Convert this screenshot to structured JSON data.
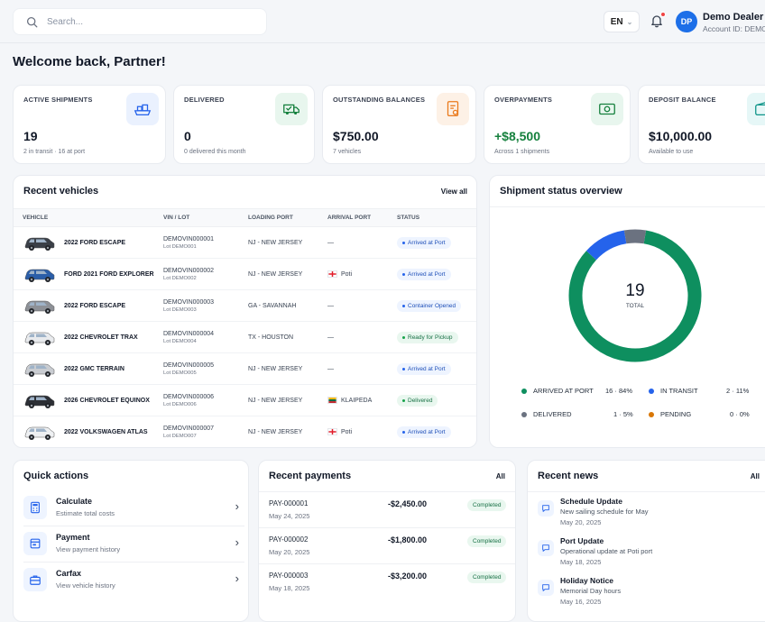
{
  "header": {
    "search_placeholder": "Search...",
    "language": "EN",
    "user": {
      "initials": "DP",
      "name": "Demo Dealer",
      "account": "Account ID: DEMO"
    }
  },
  "welcome": "Welcome back, Partner!",
  "stats": [
    {
      "label": "ACTIVE SHIPMENTS",
      "value": "19",
      "sub": "2 in transit · 16 at port",
      "icon": "ship-icon",
      "value_color": "#111827"
    },
    {
      "label": "DELIVERED",
      "value": "0",
      "sub": "0 delivered this month",
      "icon": "truck-check-icon",
      "value_color": "#111827"
    },
    {
      "label": "OUTSTANDING BALANCES",
      "value": "$750.00",
      "sub": "7 vehicles",
      "icon": "invoice-icon",
      "value_color": "#111827"
    },
    {
      "label": "OVERPAYMENTS",
      "value": "+$8,500",
      "sub": "Across 1 shipments",
      "icon": "cash-icon",
      "value_color": "#15803d"
    },
    {
      "label": "DEPOSIT BALANCE",
      "value": "$10,000.00",
      "sub": "Available to use",
      "icon": "wallet-icon",
      "value_color": "#111827"
    }
  ],
  "recent_vehicles": {
    "title": "Recent vehicles",
    "view_all": "View all",
    "columns": [
      "VEHICLE",
      "VIN / LOT",
      "LOADING PORT",
      "ARRIVAL PORT",
      "STATUS"
    ],
    "rows": [
      {
        "vehicle": "2022 FORD ESCAPE",
        "vin": "DEMOVIN000001",
        "lot": "Lot DEMO001",
        "loading": "NJ - NEW JERSEY",
        "arrival": "—",
        "flag": "",
        "status": "Arrived at Port",
        "status_tone": "blue",
        "car_color": "#3a3f47"
      },
      {
        "vehicle": "FORD 2021 FORD EXPLORER",
        "vin": "DEMOVIN000002",
        "lot": "Lot DEMO002",
        "loading": "NJ - NEW JERSEY",
        "arrival": "Poti",
        "flag": "georgia",
        "status": "Arrived at Port",
        "status_tone": "blue",
        "car_color": "#2b5ea8"
      },
      {
        "vehicle": "2022 FORD ESCAPE",
        "vin": "DEMOVIN000003",
        "lot": "Lot DEMO003",
        "loading": "GA - SAVANNAH",
        "arrival": "—",
        "flag": "",
        "status": "Container Opened",
        "status_tone": "blue",
        "car_color": "#8d9096"
      },
      {
        "vehicle": "2022 CHEVROLET TRAX",
        "vin": "DEMOVIN000004",
        "lot": "Lot DEMO004",
        "loading": "TX - HOUSTON",
        "arrival": "—",
        "flag": "",
        "status": "Ready for Pickup",
        "status_tone": "green",
        "car_color": "#e8eaed"
      },
      {
        "vehicle": "2022 GMC TERRAIN",
        "vin": "DEMOVIN000005",
        "lot": "Lot DEMO005",
        "loading": "NJ - NEW JERSEY",
        "arrival": "—",
        "flag": "",
        "status": "Arrived at Port",
        "status_tone": "blue",
        "car_color": "#c9ccd1"
      },
      {
        "vehicle": "2026 CHEVROLET EQUINOX",
        "vin": "DEMOVIN000006",
        "lot": "Lot DEMO006",
        "loading": "NJ - NEW JERSEY",
        "arrival": "KLAIPEDA",
        "flag": "lithuania",
        "status": "Delivered",
        "status_tone": "green",
        "car_color": "#2c2f35"
      },
      {
        "vehicle": "2022 VOLKSWAGEN ATLAS",
        "vin": "DEMOVIN000007",
        "lot": "Lot DEMO007",
        "loading": "NJ - NEW JERSEY",
        "arrival": "Poti",
        "flag": "georgia",
        "status": "Arrived at Port",
        "status_tone": "blue",
        "car_color": "#eef0f2"
      }
    ]
  },
  "shipment_overview": {
    "title": "Shipment status overview",
    "total": "19",
    "total_label": "TOTAL",
    "legend": [
      {
        "label": "ARRIVED AT PORT",
        "value": "16 · 84%",
        "color": "#0e8f5f"
      },
      {
        "label": "IN TRANSIT",
        "value": "2 · 11%",
        "color": "#2563eb"
      },
      {
        "label": "DELIVERED",
        "value": "1 · 5%",
        "color": "#6b7280"
      },
      {
        "label": "PENDING",
        "value": "0 · 0%",
        "color": "#d97706"
      }
    ]
  },
  "chart_data": {
    "type": "pie",
    "categories": [
      "ARRIVED AT PORT",
      "IN TRANSIT",
      "DELIVERED",
      "PENDING"
    ],
    "values": [
      16,
      2,
      1,
      0
    ],
    "colors": [
      "#0e8f5f",
      "#2563eb",
      "#6b7280",
      "#d97706"
    ]
  },
  "quick_actions": {
    "title": "Quick actions",
    "items": [
      {
        "title": "Calculate",
        "sub": "Estimate total costs",
        "icon": "calculator-icon"
      },
      {
        "title": "Payment",
        "sub": "View payment history",
        "icon": "card-icon"
      },
      {
        "title": "Carfax",
        "sub": "View vehicle history",
        "icon": "briefcase-icon"
      }
    ]
  },
  "recent_payments": {
    "title": "Recent payments",
    "all": "All",
    "items": [
      {
        "id": "PAY-000001",
        "date": "May 24, 2025",
        "amount": "-$2,450.00",
        "status": "Completed"
      },
      {
        "id": "PAY-000002",
        "date": "May 20, 2025",
        "amount": "-$1,800.00",
        "status": "Completed"
      },
      {
        "id": "PAY-000003",
        "date": "May 18, 2025",
        "amount": "-$3,200.00",
        "status": "Completed"
      }
    ]
  },
  "recent_news": {
    "title": "Recent news",
    "all": "All",
    "items": [
      {
        "title": "Schedule Update",
        "sub": "New sailing schedule for May",
        "date": "May 20, 2025"
      },
      {
        "title": "Port Update",
        "sub": "Operational update at Poti port",
        "date": "May 18, 2025"
      },
      {
        "title": "Holiday Notice",
        "sub": "Memorial Day hours",
        "date": "May 16, 2025"
      }
    ]
  }
}
